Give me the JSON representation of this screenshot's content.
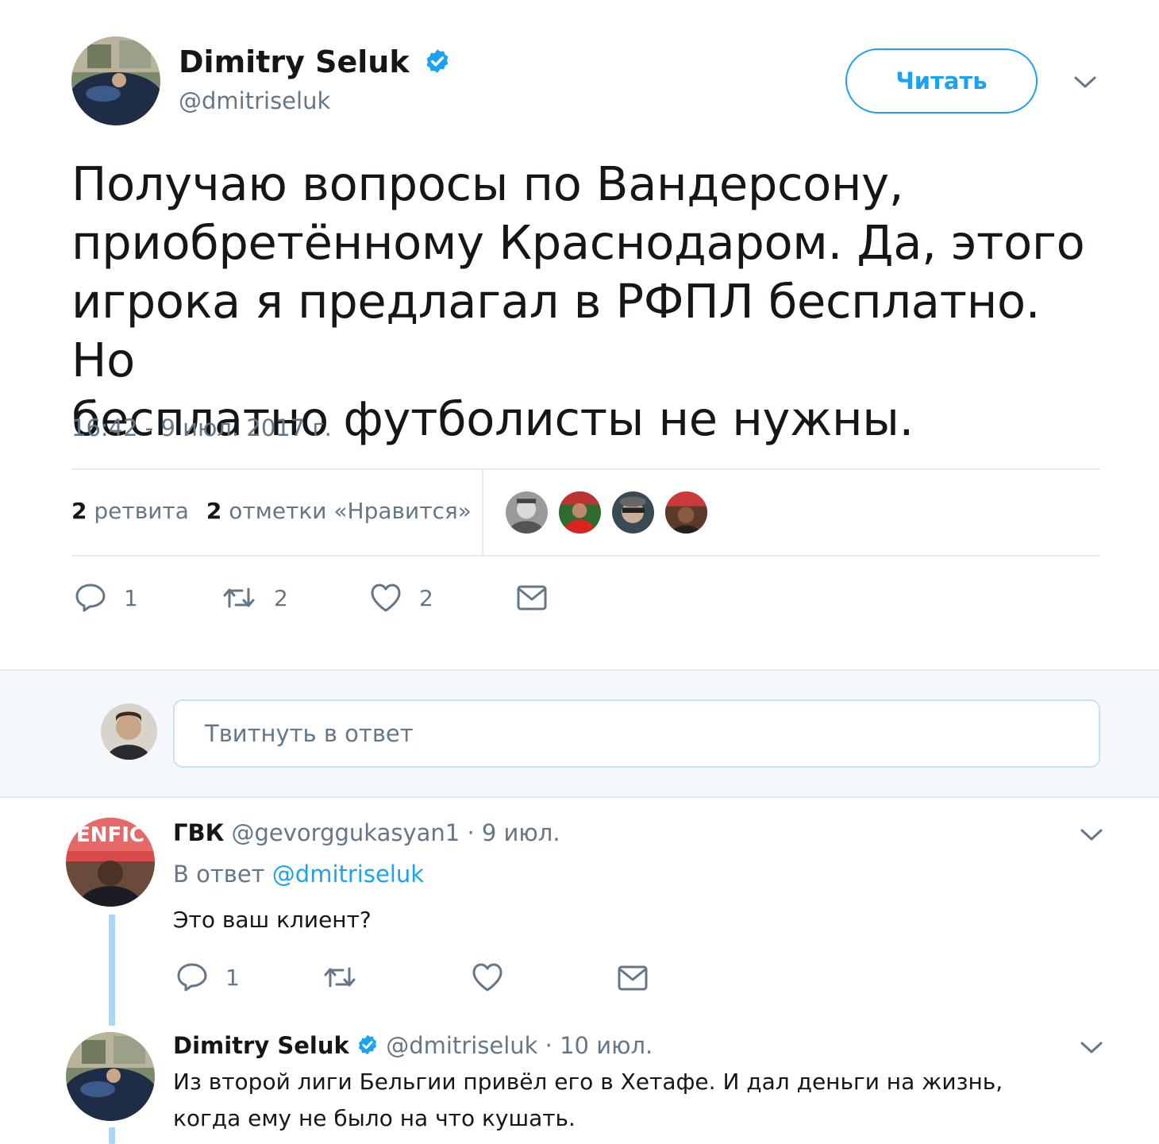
{
  "tweet": {
    "author_name": "Dimitry Seluk",
    "author_handle": "@dmitriseluk",
    "follow_label": "Читать",
    "text_lines": [
      "Получаю вопросы по Вандерсону,",
      "приобретённому Краснодаром. Да, этого",
      "игрока я предлагал в РФПЛ бесплатно. Но",
      "бесплатно футболисты не нужны."
    ],
    "timestamp": "16:42 - 9 июл. 2017 г.",
    "stats": {
      "retweets_count": "2",
      "retweets_label": "ретвита",
      "likes_count": "2",
      "likes_label": "отметки «Нравится»"
    },
    "actions": {
      "reply_count": "1",
      "retweet_count": "2",
      "like_count": "2"
    }
  },
  "reply_box": {
    "placeholder": "Твитнуть в ответ"
  },
  "replies": [
    {
      "name": "ГВК",
      "handle": "@gevorggukasyan1",
      "date": "· 9 июл.",
      "in_reply_prefix": "В ответ",
      "in_reply_handle": "@dmitriseluk",
      "text": "Это ваш клиент?",
      "reply_count": "1",
      "avatar_banner": "ENFIC"
    },
    {
      "name": "Dimitry Seluk",
      "handle": "@dmitriseluk",
      "date": "· 10 июл.",
      "text_lines": [
        "Из второй лиги Бельгии привёл его в Хетафе. И дал деньги на жизнь,",
        "когда ему не было на что кушать."
      ]
    }
  ],
  "colors": {
    "accent": "#1da1f2",
    "secondary_text": "#657786",
    "border": "#e6ecf0",
    "thread_line": "#a8d6f8"
  }
}
